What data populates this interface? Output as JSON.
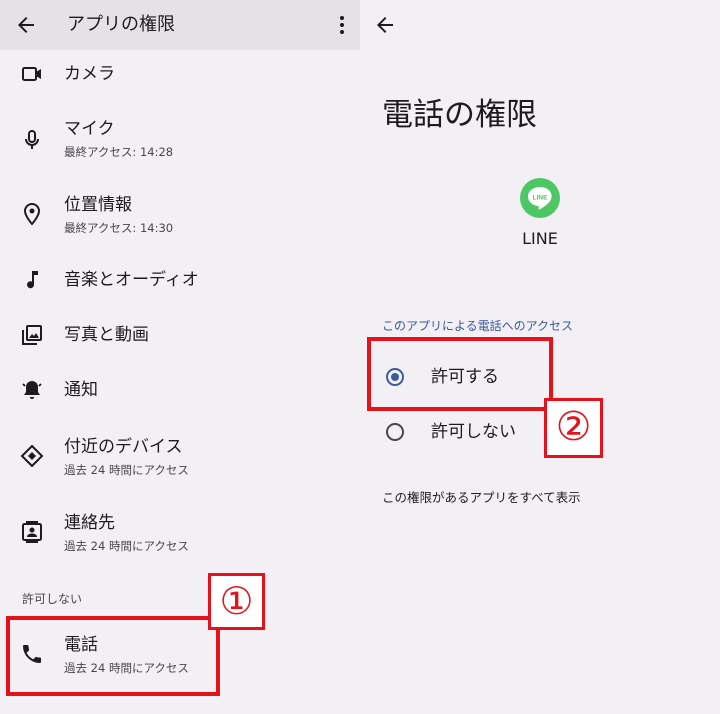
{
  "left": {
    "title": "アプリの権限",
    "items": [
      {
        "label": "カメラ",
        "sub": ""
      },
      {
        "label": "マイク",
        "sub": "最終アクセス: 14:28"
      },
      {
        "label": "位置情報",
        "sub": "最終アクセス: 14:30"
      },
      {
        "label": "音楽とオーディオ",
        "sub": ""
      },
      {
        "label": "写真と動画",
        "sub": ""
      },
      {
        "label": "通知",
        "sub": ""
      },
      {
        "label": "付近のデバイス",
        "sub": "過去 24 時間にアクセス"
      },
      {
        "label": "連絡先",
        "sub": "過去 24 時間にアクセス"
      }
    ],
    "deny_section": "許可しない",
    "phone": {
      "label": "電話",
      "sub": "過去 24 時間にアクセス"
    }
  },
  "right": {
    "title": "電話の権限",
    "app_name": "LINE",
    "logo_text": "LINE",
    "section": "このアプリによる電話へのアクセス",
    "options": [
      {
        "label": "許可する",
        "selected": true
      },
      {
        "label": "許可しない",
        "selected": false
      }
    ],
    "show_all": "この権限があるアプリをすべて表示"
  },
  "annotations": {
    "step1": "①",
    "step2": "②"
  },
  "colors": {
    "accent": "#3c5a99",
    "annotation": "#e5121b",
    "line_green": "#4cc764"
  }
}
